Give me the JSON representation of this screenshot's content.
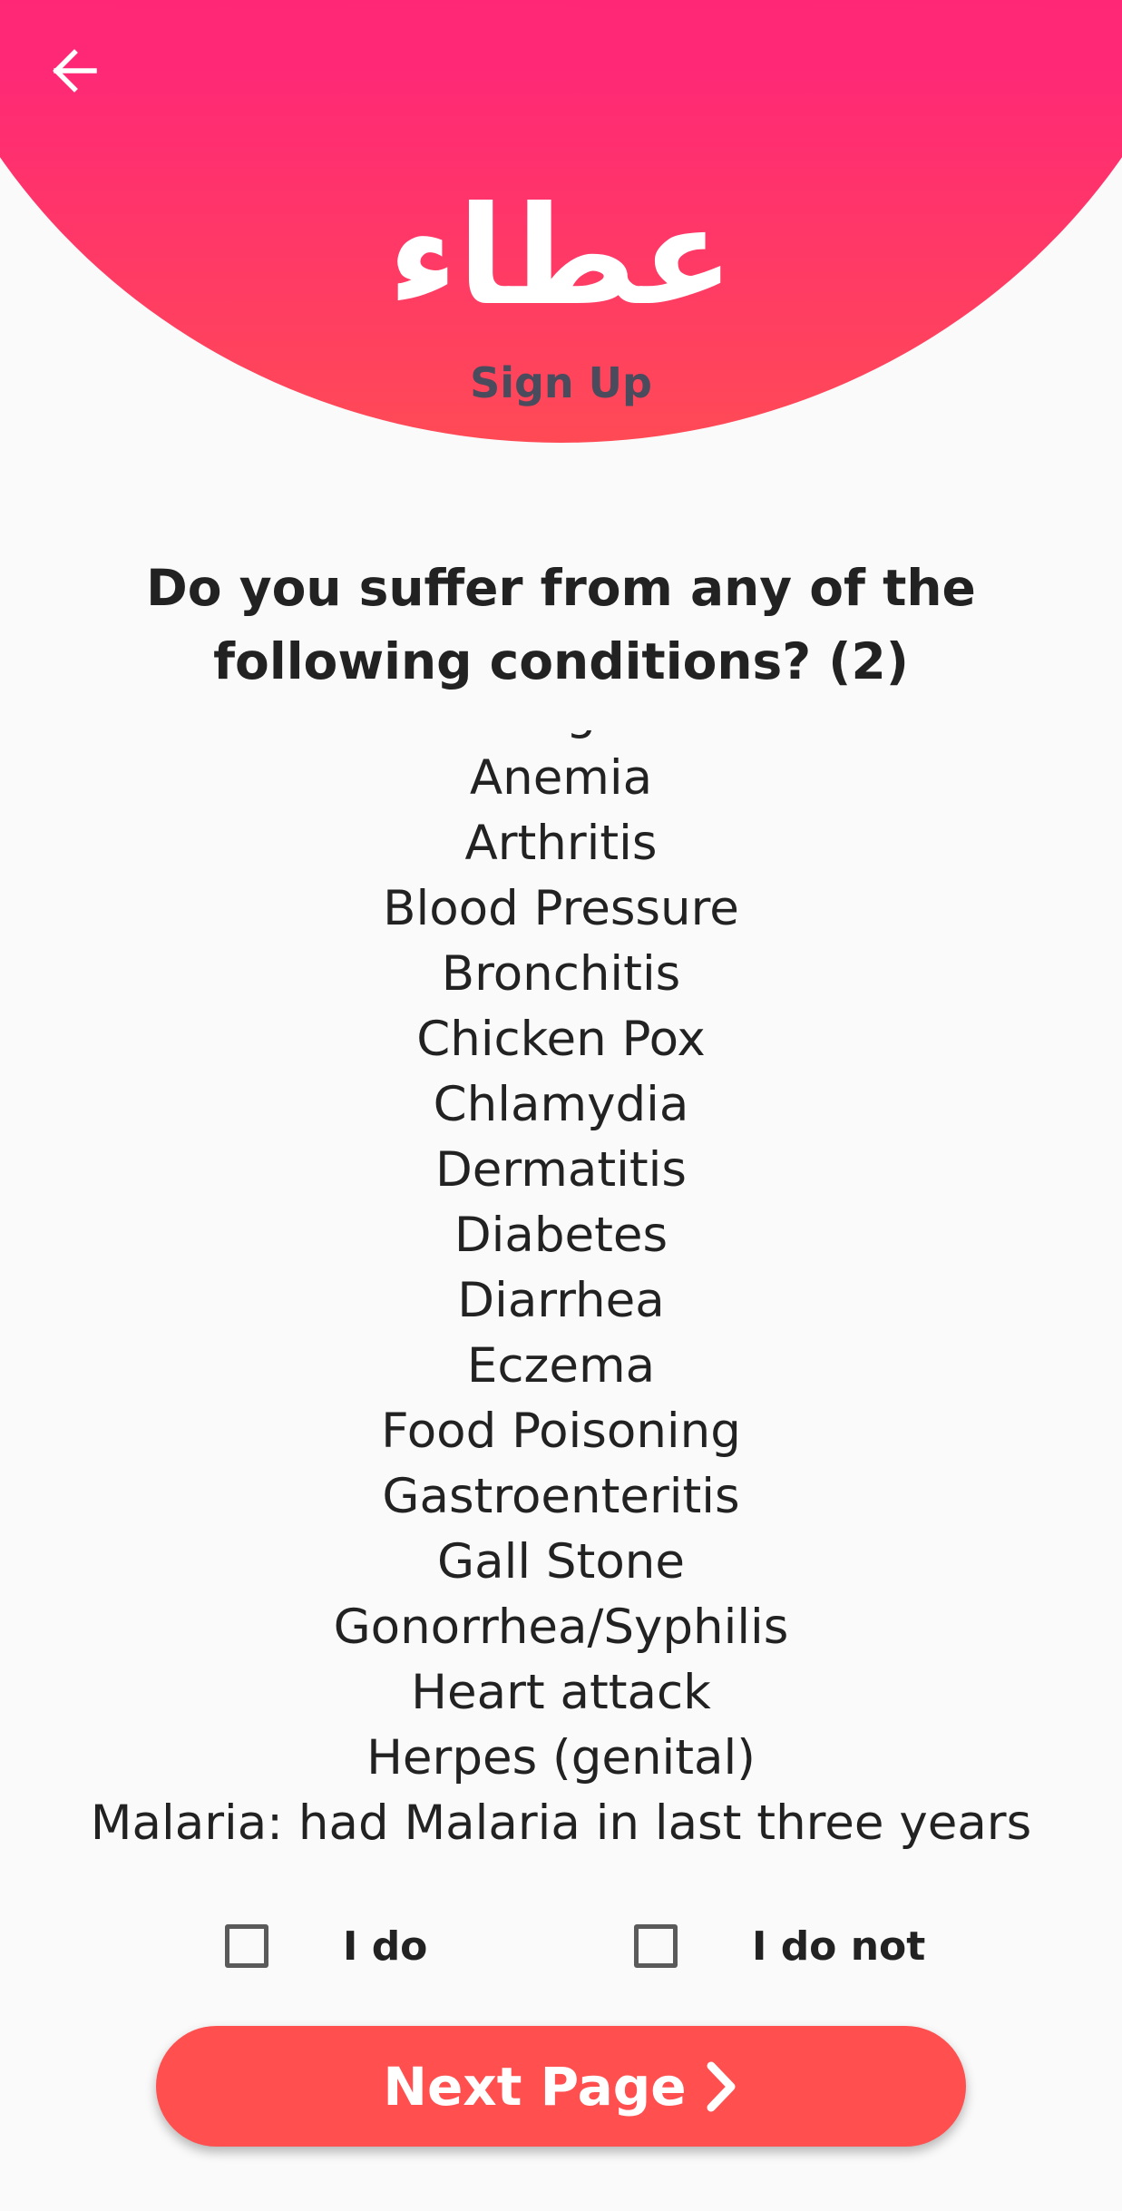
{
  "header": {
    "back_icon": "arrow-left-icon",
    "logo_text": "عطاء",
    "title": "Sign Up",
    "accent_top": "#ff1f7a",
    "accent_bottom": "#ff4a56"
  },
  "question": {
    "text": "Do you suffer from any of the following conditions? (2)"
  },
  "conditions": [
    "Allergies",
    "Anemia",
    "Arthritis",
    "Blood Pressure",
    "Bronchitis",
    "Chicken Pox",
    "Chlamydia",
    "Dermatitis",
    "Diabetes",
    "Diarrhea",
    "Eczema",
    "Food Poisoning",
    "Gastroenteritis",
    "Gall Stone",
    "Gonorrhea/Syphilis",
    "Heart attack",
    "Herpes (genital)",
    "Malaria: had Malaria in last three years"
  ],
  "options": {
    "do_label": "I do",
    "do_not_label": "I do not",
    "do_checked": false,
    "do_not_checked": false
  },
  "footer": {
    "next_label": "Next Page",
    "next_icon": "chevron-right-icon",
    "button_color": "#ff4f4f"
  }
}
